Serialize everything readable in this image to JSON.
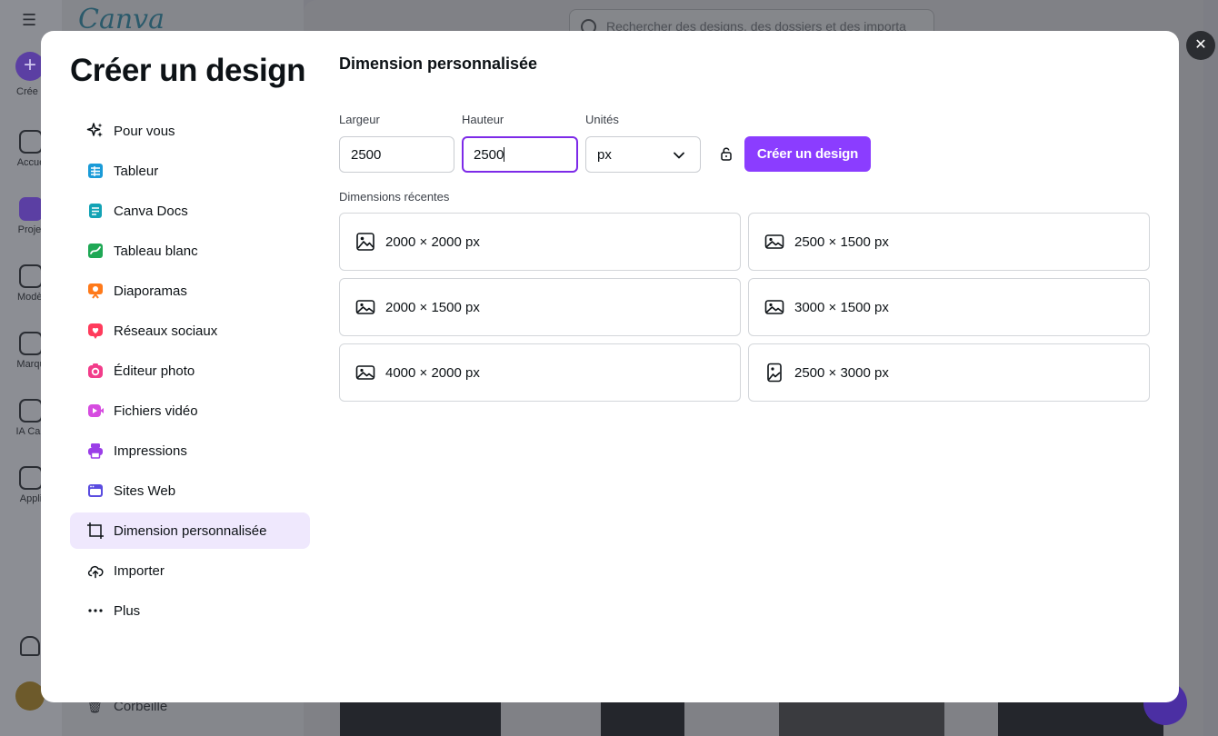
{
  "background": {
    "logo": "Canva",
    "search_placeholder": "Rechercher des designs, des dossiers et des importa",
    "rail": [
      "Crée",
      "Accue",
      "Projet",
      "Modèl",
      "Marqu",
      "IA Can",
      "Appli"
    ],
    "trash_label": "Corbeille"
  },
  "modal": {
    "title": "Créer un design",
    "close_icon": "close-icon",
    "nav": [
      {
        "label": "Pour vous",
        "icon": "sparkle-icon",
        "color": "#0d1216"
      },
      {
        "label": "Tableur",
        "icon": "sheet-icon",
        "color": "#1a9bd8"
      },
      {
        "label": "Canva Docs",
        "icon": "docs-icon",
        "color": "#13a3b5"
      },
      {
        "label": "Tableau blanc",
        "icon": "whiteboard-icon",
        "color": "#1fa855"
      },
      {
        "label": "Diaporamas",
        "icon": "presentation-icon",
        "color": "#ff7a1a"
      },
      {
        "label": "Réseaux sociaux",
        "icon": "heart-icon",
        "color": "#ff3b5c"
      },
      {
        "label": "Éditeur photo",
        "icon": "camera-icon",
        "color": "#f23c8a"
      },
      {
        "label": "Fichiers vidéo",
        "icon": "video-icon",
        "color": "#d64ce0"
      },
      {
        "label": "Impressions",
        "icon": "printer-icon",
        "color": "#9b3ee8"
      },
      {
        "label": "Sites Web",
        "icon": "website-icon",
        "color": "#5a4ce0"
      },
      {
        "label": "Dimension personnalisée",
        "icon": "custom-size-icon",
        "color": "#0d1216",
        "active": true
      },
      {
        "label": "Importer",
        "icon": "cloud-upload-icon",
        "color": "#0d1216"
      },
      {
        "label": "Plus",
        "icon": "more-icon",
        "color": "#0d1216"
      }
    ],
    "custom": {
      "section_title": "Dimension personnalisée",
      "width_label": "Largeur",
      "width_value": "2500",
      "height_label": "Hauteur",
      "height_value": "2500",
      "units_label": "Unités",
      "units_value": "px",
      "create_button": "Créer un design",
      "recent_label": "Dimensions récentes",
      "recent": [
        {
          "label": "2000 × 2000 px",
          "icon": "image-icon"
        },
        {
          "label": "2500 × 1500 px",
          "icon": "image-icon"
        },
        {
          "label": "2000 × 1500 px",
          "icon": "image-icon"
        },
        {
          "label": "3000 × 1500 px",
          "icon": "image-icon"
        },
        {
          "label": "4000 × 2000 px",
          "icon": "image-icon"
        },
        {
          "label": "2500 × 3000 px",
          "icon": "image-portrait-icon"
        }
      ]
    }
  },
  "colors": {
    "accent": "#8b3dff",
    "active_bg": "#efe8fd",
    "focus_border": "#7d2ae8"
  }
}
